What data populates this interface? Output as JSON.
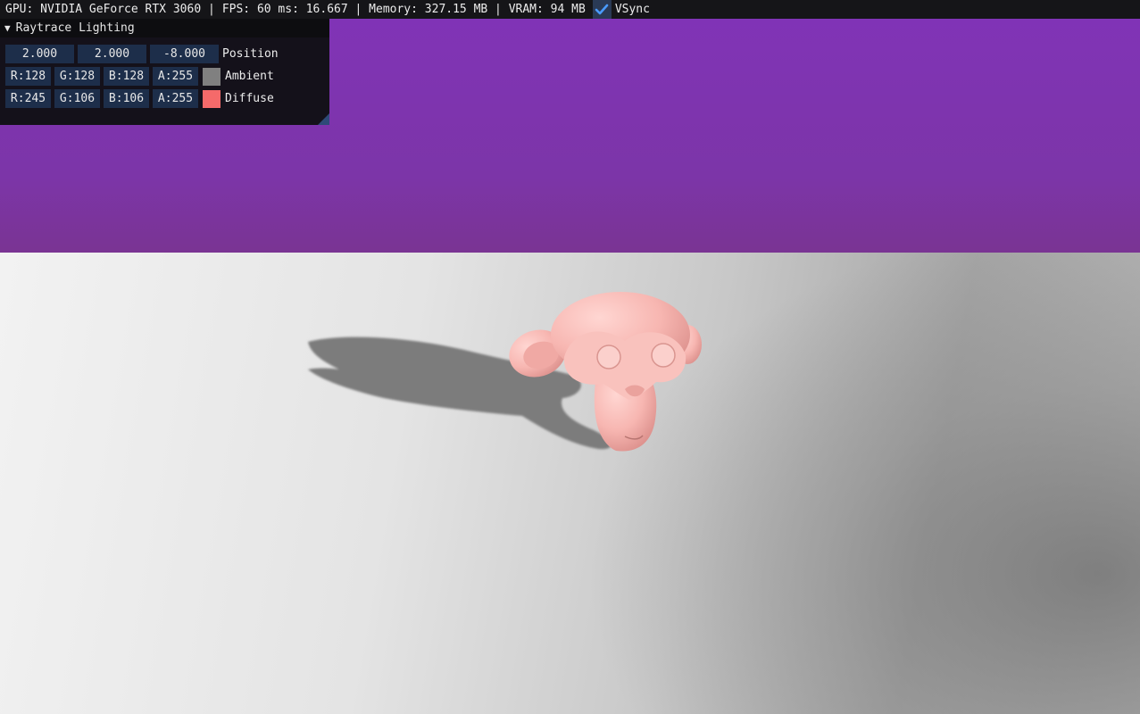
{
  "menubar": {
    "gpu": "GPU: NVIDIA GeForce RTX 3060 |",
    "fps": "FPS: 60 ms: 16.667 | Memory: 327.15 MB | VRAM: 94 MB",
    "vsync_label": "VSync",
    "vsync_checked": true
  },
  "panel": {
    "title": "Raytrace Lighting",
    "collapse_icon": "triangle-down-icon",
    "position": {
      "x": "2.000",
      "y": "2.000",
      "z": "-8.000",
      "label": "Position"
    },
    "ambient": {
      "r": "R:128",
      "g": "G:128",
      "b": "B:128",
      "a": "A:255",
      "color": "#808080",
      "label": "Ambient"
    },
    "diffuse": {
      "r": "R:245",
      "g": "G:106",
      "b": "B:106",
      "a": "A:255",
      "color": "#f56a6a",
      "label": "Diffuse"
    }
  },
  "scene": {
    "sky_color": "#8133b8",
    "floor_color": "#e6e6e6",
    "model_color": "#f7b8b3",
    "shadow_color": "#7a7a7a"
  }
}
